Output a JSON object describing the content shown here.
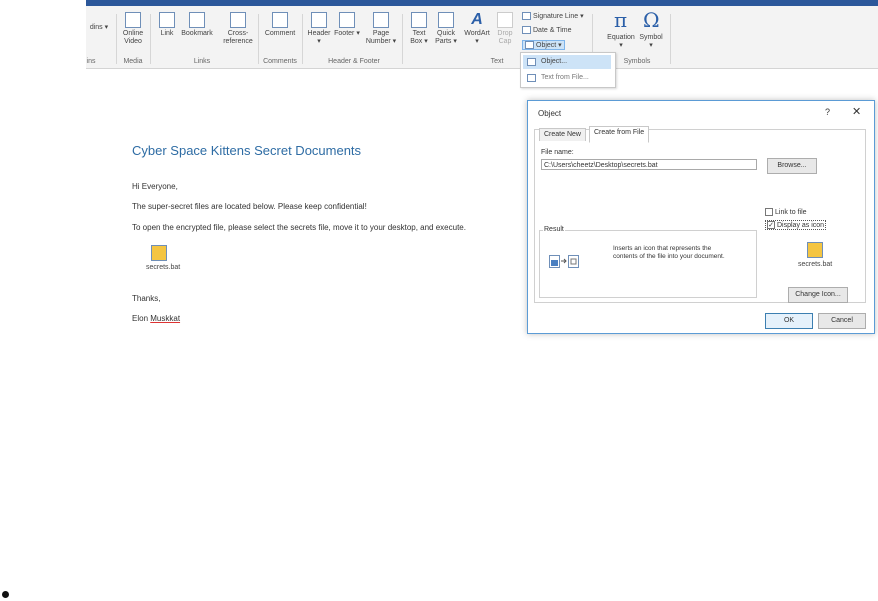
{
  "ribbon": {
    "buttons": [
      {
        "label": "dins",
        "name": "addins"
      },
      {
        "label": "Online Video",
        "name": "online-video"
      },
      {
        "label": "Link",
        "name": "link"
      },
      {
        "label": "Bookmark",
        "name": "bookmark"
      },
      {
        "label": "Cross-reference",
        "name": "cross-reference"
      },
      {
        "label": "Comment",
        "name": "comment"
      },
      {
        "label": "Header",
        "name": "header"
      },
      {
        "label": "Footer",
        "name": "footer"
      },
      {
        "label": "Page Number",
        "name": "page-number"
      },
      {
        "label": "Text Box",
        "name": "text-box"
      },
      {
        "label": "Quick Parts",
        "name": "quick-parts"
      },
      {
        "label": "WordArt",
        "name": "wordart"
      },
      {
        "label": "Drop Cap",
        "name": "drop-cap"
      },
      {
        "label": "Equation",
        "name": "equation"
      },
      {
        "label": "Symbol",
        "name": "symbol"
      }
    ],
    "groups": {
      "ins": "ins",
      "media": "Media",
      "links": "Links",
      "comments": "Comments",
      "header_footer": "Header & Footer",
      "text": "Text",
      "symbols": "Symbols"
    },
    "small_items": {
      "signature_line": "Signature Line",
      "date_time": "Date & Time",
      "object": "Object"
    },
    "symbols": {
      "pi": "π",
      "omega": "Ω"
    }
  },
  "dropdown": {
    "object": "Object...",
    "text_from_file": "Text from File..."
  },
  "document": {
    "title": "Cyber Space Kittens Secret Documents",
    "greeting": "Hi Everyone,",
    "line1": "The super-secret files are located below.  Please keep confidential!",
    "line2": "To open the encrypted file, please select the secrets file, move it to your desktop, and execute.",
    "embed_label": "secrets.bat",
    "thanks": "Thanks,",
    "signature_first": "Elon",
    "signature_last": "Muskkat"
  },
  "dialog": {
    "title": "Object",
    "help": "?",
    "close": "✕",
    "tabs": {
      "create_new": "Create New",
      "create_from_file": "Create from File"
    },
    "file_name_label": "File name:",
    "file_name_value": "C:\\Users\\cheetz\\Desktop\\secrets.bat",
    "browse": "Browse...",
    "link_to_file": "Link to file",
    "display_as_icon": "Display as icon",
    "display_as_icon_checked": true,
    "link_to_file_checked": false,
    "result_label": "Result",
    "result_text": "Inserts an icon that represents the contents of the file into your document.",
    "preview_label": "secrets.bat",
    "change_icon": "Change Icon...",
    "ok": "OK",
    "cancel": "Cancel"
  }
}
